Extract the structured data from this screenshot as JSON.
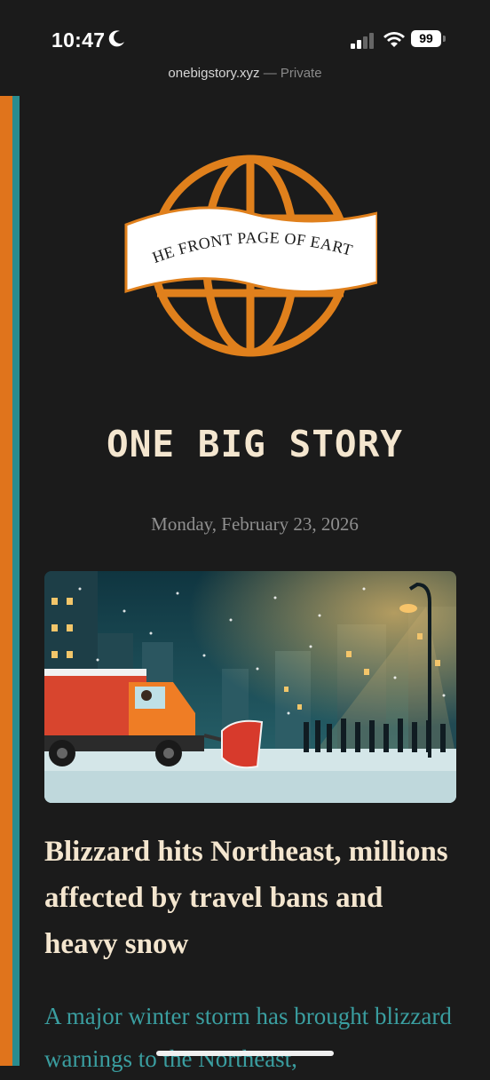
{
  "status": {
    "time": "10:47",
    "battery": "99"
  },
  "browser": {
    "domain": "onebigstory.xyz",
    "separator": " — ",
    "mode": "Private"
  },
  "logo": {
    "banner_text": "THE FRONT PAGE OF EARTH",
    "colors": {
      "globe": "#e0801c",
      "banner": "#ffffff",
      "banner_text": "#1a1a1a"
    }
  },
  "site": {
    "title": "ONE BIG STORY",
    "date": "Monday, February 23, 2026"
  },
  "article": {
    "headline": "Blizzard hits Northeast, millions affected by travel bans and heavy snow",
    "summary": "A major winter storm has brought blizzard warnings to the Northeast,"
  },
  "colors": {
    "background": "#1b1b1b",
    "title": "#f4e6cf",
    "accent_orange": "#e0741c",
    "accent_teal": "#2a8c8f",
    "summary_text": "#3a9ea0"
  }
}
